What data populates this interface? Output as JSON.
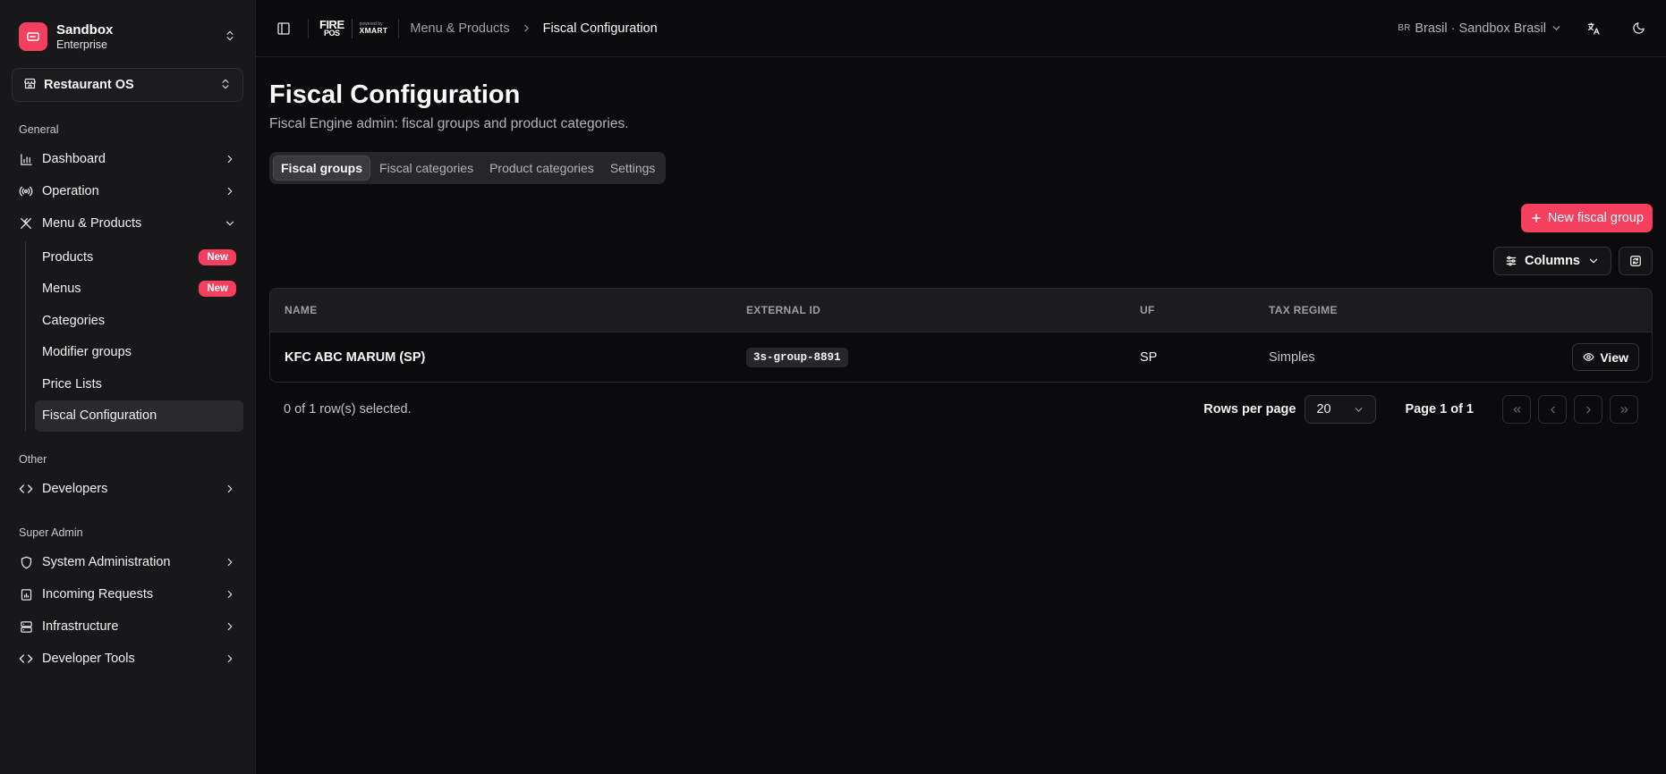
{
  "colors": {
    "accent": "#f43f5e",
    "sidebar_bg": "#18181b",
    "page_bg": "#0b0b0d"
  },
  "org": {
    "name": "Sandbox",
    "plan": "Enterprise",
    "icon": "ticket-icon"
  },
  "workspace": {
    "label": "Restaurant OS",
    "icon": "store-icon"
  },
  "sidebar": {
    "general_label": "General",
    "general": [
      {
        "label": "Dashboard",
        "icon": "bar-chart-icon"
      },
      {
        "label": "Operation",
        "icon": "radio-icon"
      },
      {
        "label": "Menu & Products",
        "icon": "utensils-icon",
        "expanded": true
      }
    ],
    "menu_products_items": [
      {
        "label": "Products",
        "badge": "New"
      },
      {
        "label": "Menus",
        "badge": "New"
      },
      {
        "label": "Categories"
      },
      {
        "label": "Modifier groups"
      },
      {
        "label": "Price Lists"
      },
      {
        "label": "Fiscal Configuration",
        "active": true
      }
    ],
    "other_label": "Other",
    "other": [
      {
        "label": "Developers",
        "icon": "code-icon"
      }
    ],
    "superadmin_label": "Super Admin",
    "superadmin": [
      {
        "label": "System Administration",
        "icon": "shield-icon"
      },
      {
        "label": "Incoming Requests",
        "icon": "file-chart-icon"
      },
      {
        "label": "Infrastructure",
        "icon": "server-icon"
      },
      {
        "label": "Developer Tools",
        "icon": "code-icon"
      }
    ]
  },
  "topbar": {
    "brand_fire": "FIRE",
    "brand_pos": "POS",
    "brand_powered": "powered by",
    "brand_xmart": "XMART",
    "breadcrumb": [
      "Menu & Products",
      "Fiscal Configuration"
    ],
    "region_code": "BR",
    "region_label": "Brasil · Sandbox Brasil"
  },
  "page": {
    "title": "Fiscal Configuration",
    "subtitle": "Fiscal Engine admin: fiscal groups and product categories."
  },
  "tabs": [
    {
      "label": "Fiscal groups",
      "active": true
    },
    {
      "label": "Fiscal categories"
    },
    {
      "label": "Product categories"
    },
    {
      "label": "Settings"
    }
  ],
  "actions": {
    "new_label": "New fiscal group",
    "columns_label": "Columns"
  },
  "table": {
    "headers": [
      "NAME",
      "EXTERNAL ID",
      "UF",
      "TAX REGIME"
    ],
    "rows": [
      {
        "name": "KFC ABC MARUM (SP)",
        "external_id": "3s-group-8891",
        "uf": "SP",
        "tax_regime": "Simples",
        "action": "View"
      }
    ]
  },
  "footer": {
    "selected": "0 of 1 row(s) selected.",
    "rows_per_page_label": "Rows per page",
    "rows_per_page_value": "20",
    "page_info": "Page 1 of 1"
  }
}
